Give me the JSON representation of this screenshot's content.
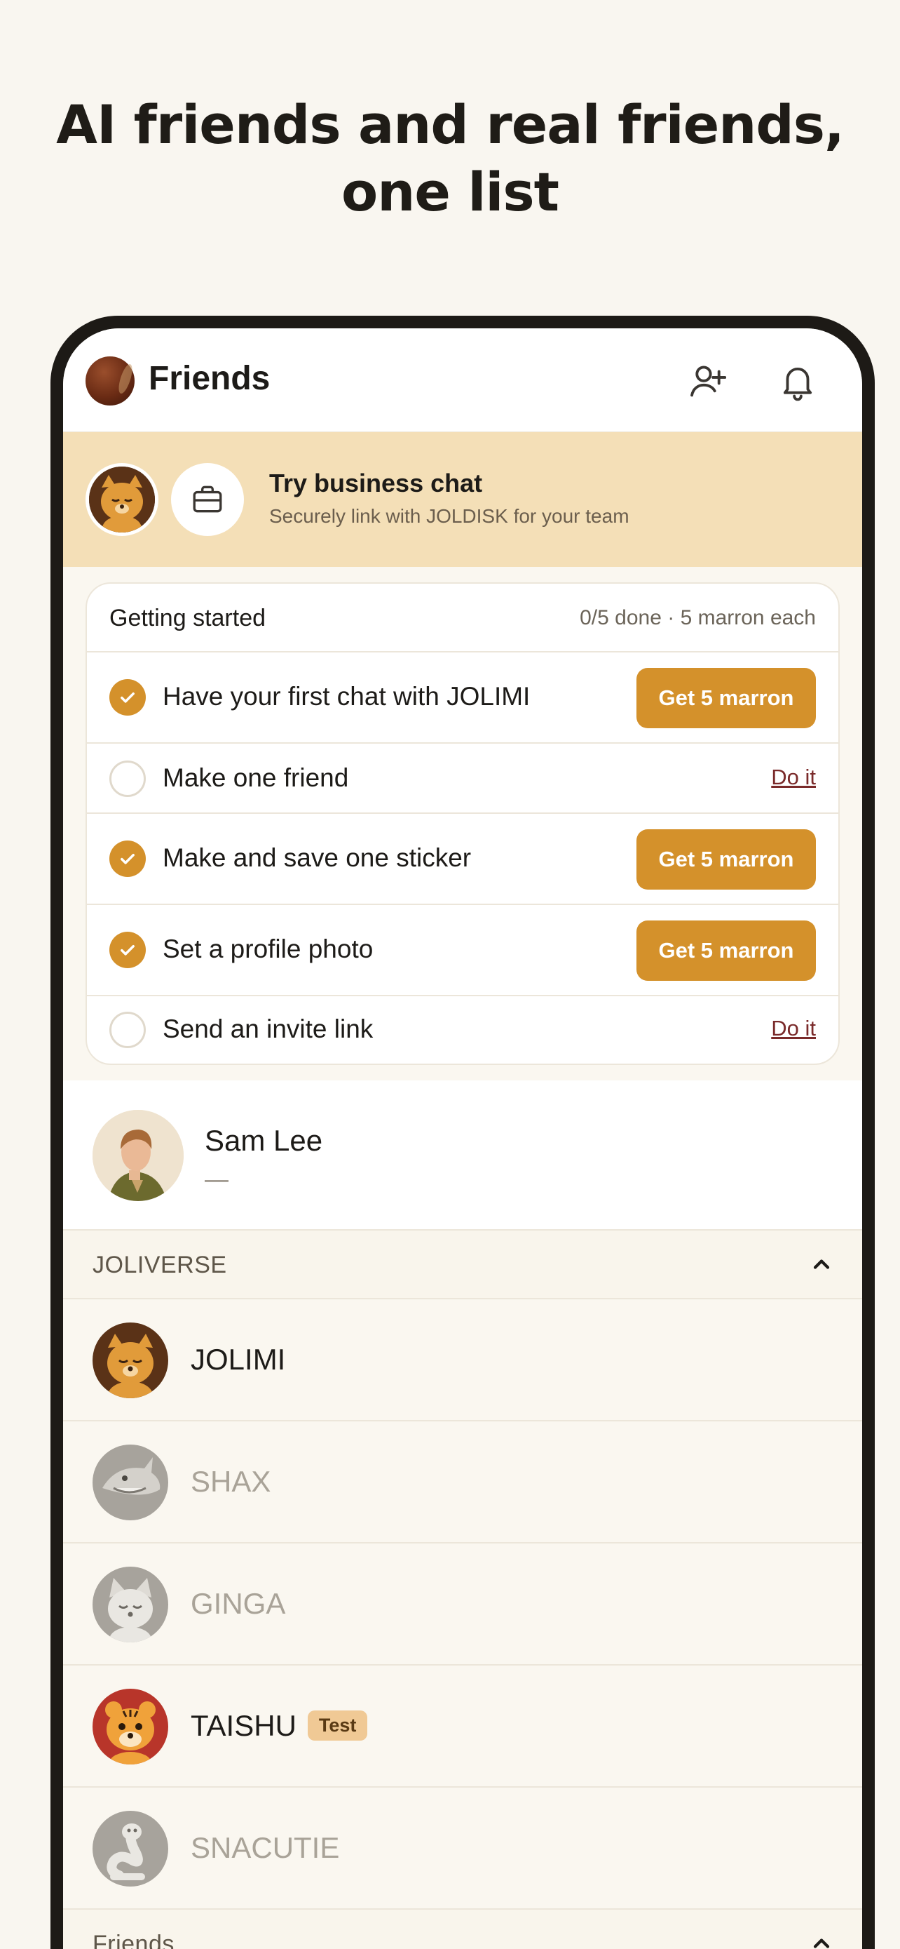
{
  "headline": {
    "line1": "AI friends and real friends,",
    "line2": "one list"
  },
  "topbar": {
    "title": "Friends",
    "add_friend_icon": "person-plus-icon",
    "notifications_icon": "bell-icon"
  },
  "business_banner": {
    "title": "Try business chat",
    "subtitle": "Securely link with JOLDISK for your team"
  },
  "getting_started": {
    "title": "Getting started",
    "meta": "0/5 done · 5 marron each",
    "tasks": [
      {
        "label": "Have your first chat with JOLIMI",
        "done": true,
        "action": "Get 5 marron"
      },
      {
        "label": "Make one friend",
        "done": false,
        "action": "Do it"
      },
      {
        "label": "Make and save one sticker",
        "done": true,
        "action": "Get 5 marron"
      },
      {
        "label": "Set a profile photo",
        "done": true,
        "action": "Get 5 marron"
      },
      {
        "label": "Send an invite link",
        "done": false,
        "action": "Do it"
      }
    ]
  },
  "profile": {
    "name": "Sam Lee",
    "status": "—"
  },
  "joliverse": {
    "label": "JOLIVERSE",
    "items": [
      {
        "name": "JOLIMI",
        "active": true
      },
      {
        "name": "SHAX",
        "active": false
      },
      {
        "name": "GINGA",
        "active": false
      },
      {
        "name": "TAISHU",
        "active": true,
        "badge": "Test"
      },
      {
        "name": "SNACUTIE",
        "active": false
      }
    ]
  },
  "friends_section": {
    "label": "Friends"
  },
  "colors": {
    "accent": "#d4912b",
    "banner": "#f4dfb7",
    "background": "#faf7f0"
  }
}
